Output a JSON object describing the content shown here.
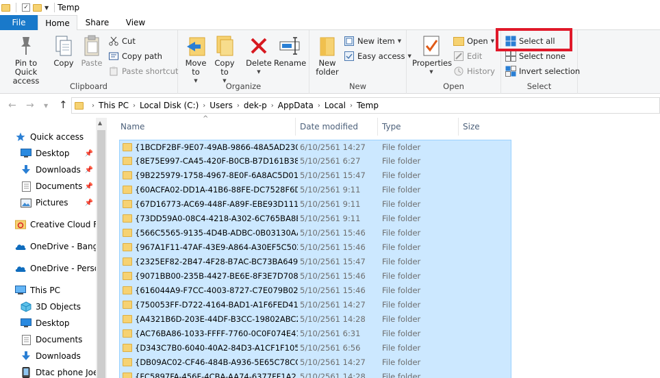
{
  "window": {
    "title": "Temp"
  },
  "ribbon": {
    "tabs": [
      "File",
      "Home",
      "Share",
      "View"
    ],
    "clipboard": {
      "label": "Clipboard",
      "pin": "Pin to Quick access",
      "copy": "Copy",
      "paste": "Paste",
      "cut": "Cut",
      "copy_path": "Copy path",
      "paste_shortcut": "Paste shortcut"
    },
    "organize": {
      "label": "Organize",
      "move_to": "Move to",
      "copy_to": "Copy to",
      "delete": "Delete",
      "rename": "Rename"
    },
    "new": {
      "label": "New",
      "new_folder": "New folder",
      "new_item": "New item",
      "easy_access": "Easy access"
    },
    "open": {
      "label": "Open",
      "properties": "Properties",
      "open": "Open",
      "edit": "Edit",
      "history": "History"
    },
    "select": {
      "label": "Select",
      "select_all": "Select all",
      "select_none": "Select none",
      "invert_selection": "Invert selection"
    }
  },
  "address": {
    "crumbs": [
      "This PC",
      "Local Disk (C:)",
      "Users",
      "dek-p",
      "AppData",
      "Local",
      "Temp"
    ]
  },
  "nav": {
    "items": [
      {
        "label": "Quick access",
        "icon": "star-icon"
      },
      {
        "label": "Desktop",
        "icon": "desktop-icon",
        "pinned": true
      },
      {
        "label": "Downloads",
        "icon": "download-icon",
        "pinned": true
      },
      {
        "label": "Documents",
        "icon": "documents-icon",
        "pinned": true
      },
      {
        "label": "Pictures",
        "icon": "pictures-icon",
        "pinned": true
      },
      {
        "label": "Creative Cloud Fil",
        "icon": "creative-cloud-icon"
      },
      {
        "label": "OneDrive - Bangk",
        "icon": "onedrive-icon"
      },
      {
        "label": "OneDrive - Persor",
        "icon": "onedrive-icon"
      },
      {
        "label": "This PC",
        "icon": "computer-icon"
      },
      {
        "label": "3D Objects",
        "icon": "cube-icon"
      },
      {
        "label": "Desktop",
        "icon": "desktop-icon"
      },
      {
        "label": "Documents",
        "icon": "documents-icon"
      },
      {
        "label": "Downloads",
        "icon": "download-icon"
      },
      {
        "label": "Dtac phone Joey",
        "icon": "phone-icon"
      }
    ]
  },
  "columns": {
    "name": "Name",
    "date": "Date modified",
    "type": "Type",
    "size": "Size"
  },
  "files": [
    {
      "name": "{1BCDF2BF-9E07-49AB-9866-48A5AD230...",
      "date": "6/10/2561 14:27",
      "type": "File folder"
    },
    {
      "name": "{8E75E997-CA45-420F-B0CB-B7D161B384...",
      "date": "5/10/2561 6:27",
      "type": "File folder"
    },
    {
      "name": "{9B225979-1758-4967-8E0F-6A8AC5D010...",
      "date": "5/10/2561 15:47",
      "type": "File folder"
    },
    {
      "name": "{60ACFA02-DD1A-41B6-88FE-DC7528F6D...",
      "date": "5/10/2561 9:11",
      "type": "File folder"
    },
    {
      "name": "{67D16773-AC69-448F-A89F-EBE93D1113...",
      "date": "5/10/2561 9:11",
      "type": "File folder"
    },
    {
      "name": "{73DD59A0-08C4-4218-A302-6C765BA8E...",
      "date": "5/10/2561 9:11",
      "type": "File folder"
    },
    {
      "name": "{566C5565-9135-4D4B-ADBC-0B03130AA...",
      "date": "5/10/2561 15:46",
      "type": "File folder"
    },
    {
      "name": "{967A1F11-47AF-43E9-A864-A30EF5C502...",
      "date": "5/10/2561 15:46",
      "type": "File folder"
    },
    {
      "name": "{2325EF82-2B47-4F28-B7AC-BC73BA6496...",
      "date": "5/10/2561 15:47",
      "type": "File folder"
    },
    {
      "name": "{9071BB00-235B-4427-BE6E-8F3E7D708D...",
      "date": "5/10/2561 15:46",
      "type": "File folder"
    },
    {
      "name": "{616044A9-F7CC-4003-8727-C7E079B028...",
      "date": "5/10/2561 15:46",
      "type": "File folder"
    },
    {
      "name": "{750053FF-D722-4164-BAD1-A1F6FED414...",
      "date": "5/10/2561 14:27",
      "type": "File folder"
    },
    {
      "name": "{A4321B6D-203E-44DF-B3CC-19802ABC2...",
      "date": "5/10/2561 14:28",
      "type": "File folder"
    },
    {
      "name": "{AC76BA86-1033-FFFF-7760-0C0F074E41...",
      "date": "5/10/2561 6:31",
      "type": "File folder"
    },
    {
      "name": "{D343C7B0-6040-40A2-84D3-A1CF1F1054...",
      "date": "5/10/2561 6:56",
      "type": "File folder"
    },
    {
      "name": "{DB09AC02-CF46-484B-A936-5E65C78CC...",
      "date": "5/10/2561 14:27",
      "type": "File folder"
    },
    {
      "name": "{FC5897FA-456F-4CBA-AA74-6377FF1A2...",
      "date": "5/10/2561 14:28",
      "type": "File folder"
    }
  ]
}
